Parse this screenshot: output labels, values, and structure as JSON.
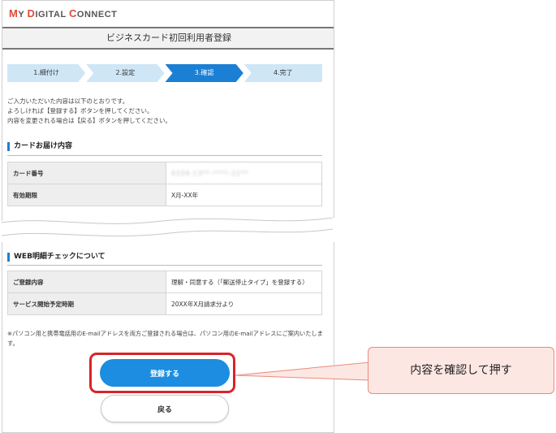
{
  "logo": {
    "m": "M",
    "y": "Y ",
    "d": "D",
    "igital": "IGITAL ",
    "c": "C",
    "onnect": "ONNECT"
  },
  "page_title": "ビジネスカード初回利用者登録",
  "steps": [
    {
      "label": "1.細付け",
      "active": false
    },
    {
      "label": "2.設定",
      "active": false
    },
    {
      "label": "3.確認",
      "active": true
    },
    {
      "label": "4.完了",
      "active": false
    }
  ],
  "intro": [
    "ご入力いただいた内容は以下のとおりです。",
    "よろしければ【登録する】ボタンを押してください。",
    "内容を変更される場合は【戻る】ボタンを押してください。"
  ],
  "card_section": {
    "heading": "カードお届け内容",
    "rows": [
      {
        "label": "カード番号",
        "value": "4334-13**-****-22**"
      },
      {
        "label": "有効期限",
        "value": "X月-XX年"
      }
    ]
  },
  "web_section": {
    "heading": "WEB明細チェックについて",
    "rows": [
      {
        "label": "ご登録内容",
        "value": "理解・同意する（「郵送停止タイプ」を登録する）"
      },
      {
        "label": "サービス開始予定時期",
        "value": "20XX年X月請求分より"
      }
    ]
  },
  "note": "※パソコン用と携帯電話用のE-mailアドレスを両方ご登録される場合は、パソコン用のE-mailアドレスにご案内いたします。",
  "buttons": {
    "register": "登録する",
    "back": "戻る"
  },
  "callout": "内容を確認して押す",
  "colors": {
    "accent": "#1b7fd4",
    "highlight": "#d9232a",
    "callout_bg": "#fde7e3"
  }
}
